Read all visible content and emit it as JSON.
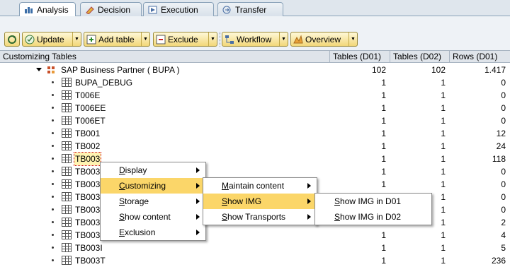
{
  "tabs": [
    {
      "label": "Analysis",
      "icon": "analysis-icon"
    },
    {
      "label": "Decision",
      "icon": "pencil-icon"
    },
    {
      "label": "Execution",
      "icon": "execution-icon"
    },
    {
      "label": "Transfer",
      "icon": "transfer-icon"
    }
  ],
  "toolbar": {
    "update": "Update",
    "add_table": "Add table",
    "exclude": "Exclude",
    "workflow": "Workflow",
    "overview": "Overview"
  },
  "table": {
    "headers": [
      "Customizing Tables",
      "Tables (D01)",
      "Tables (D02)",
      "Rows (D01)"
    ],
    "root": {
      "label": "SAP Business Partner ( BUPA )",
      "t1": "102",
      "t2": "102",
      "rows": "1.417"
    },
    "rows": [
      {
        "name": "BUPA_DEBUG",
        "t1": "1",
        "t2": "1",
        "rows": "0"
      },
      {
        "name": "T006E",
        "t1": "1",
        "t2": "1",
        "rows": "0"
      },
      {
        "name": "T006EE",
        "t1": "1",
        "t2": "1",
        "rows": "0"
      },
      {
        "name": "T006ET",
        "t1": "1",
        "t2": "1",
        "rows": "0"
      },
      {
        "name": "TB001",
        "t1": "1",
        "t2": "1",
        "rows": "12"
      },
      {
        "name": "TB002",
        "t1": "1",
        "t2": "1",
        "rows": "24"
      },
      {
        "name": "TB003",
        "t1": "1",
        "t2": "1",
        "rows": "118"
      },
      {
        "name": "TB003",
        "t1": "1",
        "t2": "1",
        "rows": "0"
      },
      {
        "name": "TB003",
        "t1": "1",
        "t2": "1",
        "rows": "0"
      },
      {
        "name": "TB003",
        "t1": "1",
        "t2": "1",
        "rows": "0"
      },
      {
        "name": "TB003",
        "t1": "1",
        "t2": "1",
        "rows": "0"
      },
      {
        "name": "TB003",
        "t1": "1",
        "t2": "1",
        "rows": "2"
      },
      {
        "name": "TB003",
        "t1": "1",
        "t2": "1",
        "rows": "4"
      },
      {
        "name": "TB003I",
        "t1": "1",
        "t2": "1",
        "rows": "5"
      },
      {
        "name": "TB003T",
        "t1": "1",
        "t2": "1",
        "rows": "236"
      }
    ]
  },
  "menu1": [
    {
      "label": "Display",
      "mn": "D",
      "rest": "isplay"
    },
    {
      "label": "Customizing",
      "mn": "C",
      "rest": "ustomizing"
    },
    {
      "label": "Storage",
      "mn": "S",
      "rest": "torage"
    },
    {
      "label": "Show content",
      "mn": "S",
      "rest": "how content"
    },
    {
      "label": "Exclusion",
      "mn": "E",
      "rest": "xclusion"
    }
  ],
  "menu2": [
    {
      "label": "Maintain content",
      "mn": "M",
      "rest": "aintain content"
    },
    {
      "label": "Show IMG",
      "mn": "S",
      "rest": "how IMG"
    },
    {
      "label": "Show Transports",
      "mn": "S",
      "rest": "how Transports"
    }
  ],
  "menu3": [
    {
      "label": "Show IMG in D01",
      "mn": "S",
      "rest": "how IMG in D01"
    },
    {
      "label": "Show IMG in D02",
      "mn": "S",
      "rest": "how IMG in D02"
    }
  ],
  "colors": {
    "highlight": "#fbd669",
    "button": "#f2d779"
  }
}
